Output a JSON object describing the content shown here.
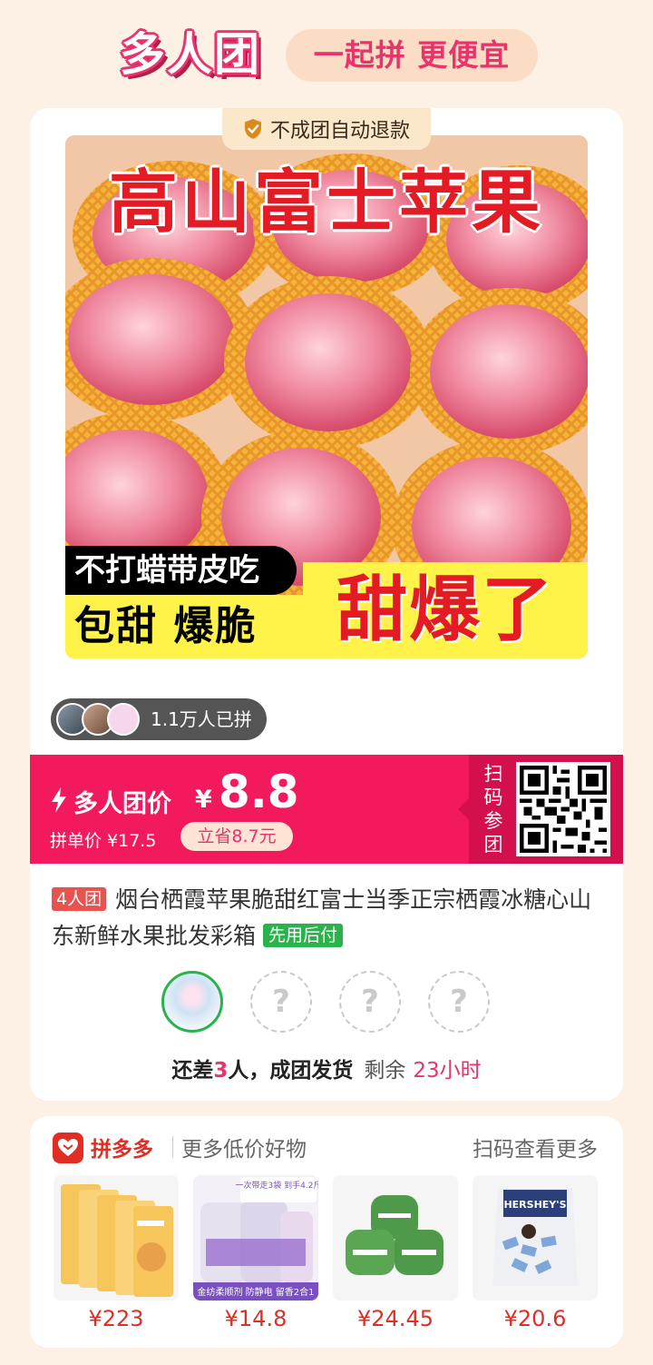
{
  "header": {
    "brand": "多人团",
    "slogan": "一起拼 更便宜"
  },
  "product": {
    "refund_tag": "不成团自动退款",
    "image_text": {
      "title": "高山富士苹果",
      "tag_wax": "不打蜡带皮吃",
      "tag_sweet": "包甜 爆脆",
      "tag_burst": "甜爆了"
    },
    "joined_count": "1.1万人已拼",
    "group_price_label": "多人团价",
    "currency": "¥",
    "group_price": "8.8",
    "single_price_label": "拼单价 ¥17.5",
    "save_label": "立省8.7元",
    "scan_label": "扫码参团",
    "group_size_badge": "4人团",
    "title": "烟台栖霞苹果脆甜红富士当季正宗栖霞冰糖心山东新鲜水果批发彩箱",
    "pay_later_badge": "先用后付",
    "slot_placeholder": "?",
    "status": {
      "prefix": "还差",
      "count": "3",
      "suffix": "人，成团发货",
      "remain_label": "剩余",
      "remain_time": "23小时"
    }
  },
  "recommend": {
    "platform": "拼多多",
    "subtitle": "更多低价好物",
    "more": "扫码查看更多",
    "items": [
      {
        "price": "¥223",
        "banner": ""
      },
      {
        "price": "¥14.8",
        "banner": "一次带走3袋 到手4.2斤",
        "footer": "金纺柔顺剂 防静电 留香2合1"
      },
      {
        "price": "¥24.45",
        "banner": ""
      },
      {
        "price": "¥20.6",
        "banner": "HERSHEY'S"
      }
    ]
  },
  "colors": {
    "accent": "#f21a5d",
    "brand_pink": "#e8336b",
    "pdd_red": "#e02e24",
    "success_green": "#2bb24c"
  }
}
